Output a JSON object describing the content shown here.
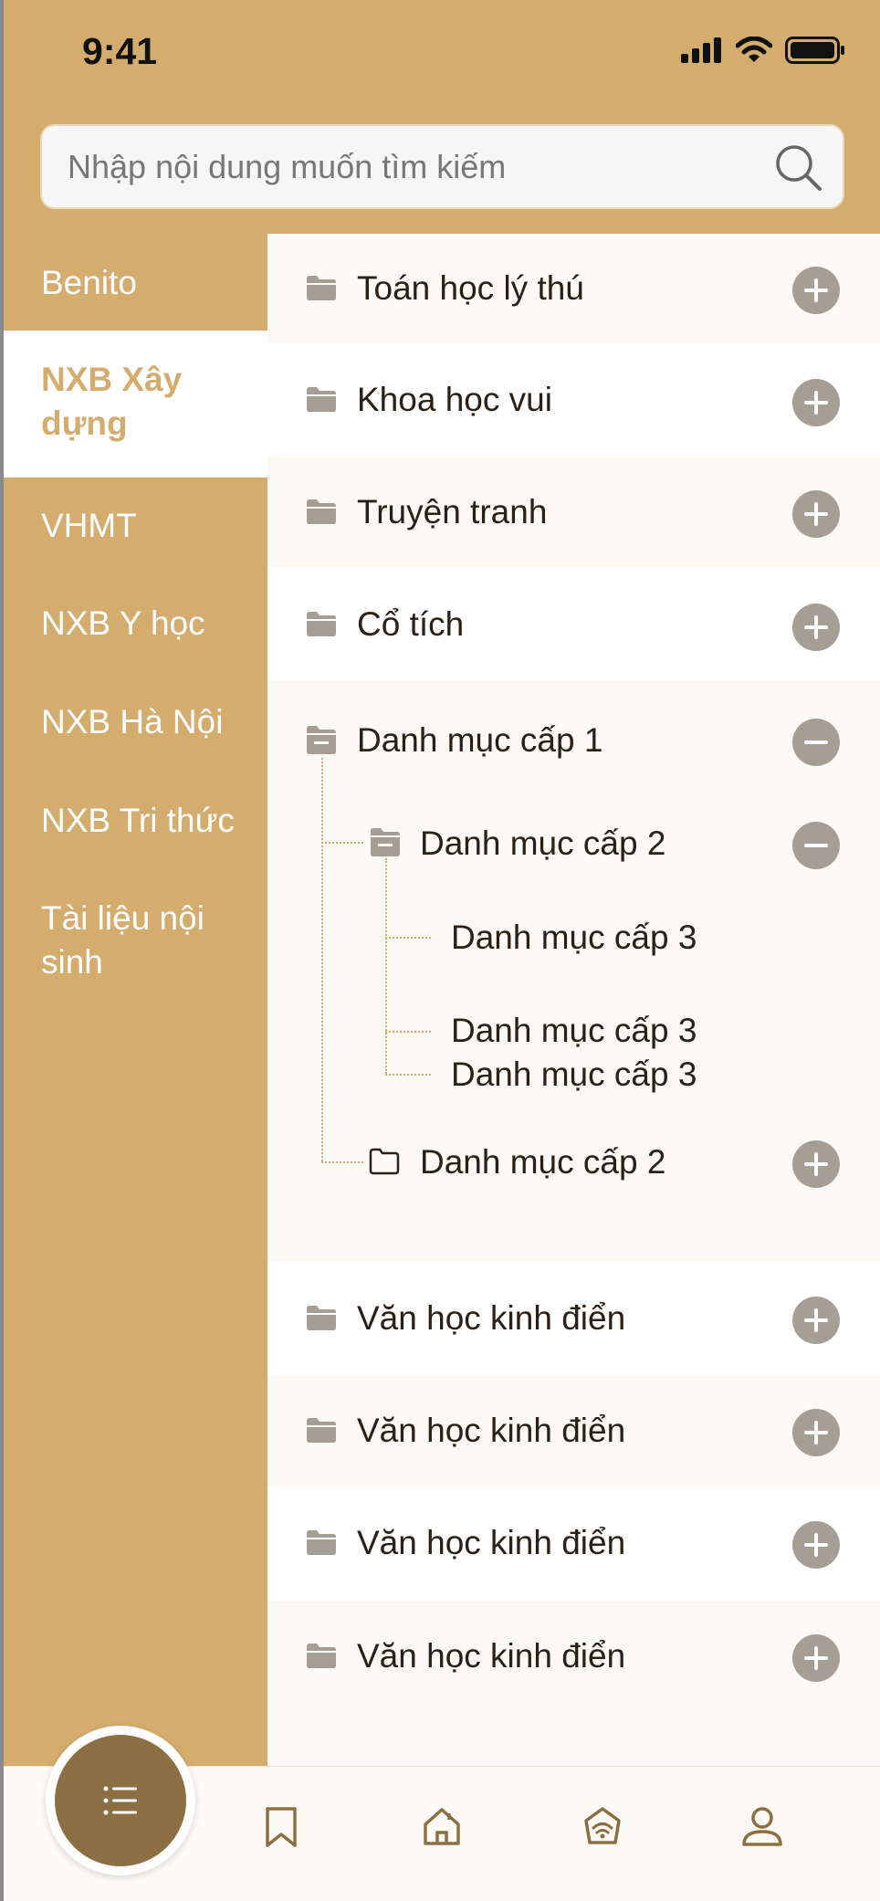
{
  "status_bar": {
    "time": "9:41"
  },
  "search": {
    "placeholder": "Nhập nội dung muốn tìm kiếm",
    "value": ""
  },
  "sidebar": {
    "items": [
      {
        "label": "Benito",
        "active": false
      },
      {
        "label": "NXB Xây dựng",
        "active": true
      },
      {
        "label": "VHMT",
        "active": false
      },
      {
        "label": "NXB Y học",
        "active": false
      },
      {
        "label": "NXB Hà Nội",
        "active": false
      },
      {
        "label": "NXB Tri thức",
        "active": false
      },
      {
        "label": "Tài liệu nội sinh",
        "active": false
      }
    ]
  },
  "categories": [
    {
      "label": "Toán học lý thú",
      "state": "collapsed"
    },
    {
      "label": "Khoa học vui",
      "state": "collapsed"
    },
    {
      "label": "Truyện tranh",
      "state": "collapsed"
    },
    {
      "label": "Cổ tích",
      "state": "collapsed"
    },
    {
      "label": "Danh mục cấp 1",
      "state": "expanded",
      "children": [
        {
          "label": "Danh mục cấp 2",
          "state": "expanded",
          "children": [
            {
              "label": "Danh mục cấp 3"
            },
            {
              "label": "Danh mục cấp 3"
            },
            {
              "label": "Danh mục cấp 3"
            }
          ]
        },
        {
          "label": "Danh mục cấp 2",
          "state": "collapsed"
        }
      ]
    },
    {
      "label": "Văn học kinh điển",
      "state": "collapsed"
    },
    {
      "label": "Văn học kinh điển",
      "state": "collapsed"
    },
    {
      "label": "Văn học kinh điển",
      "state": "collapsed"
    },
    {
      "label": "Văn học kinh điển",
      "state": "collapsed"
    }
  ],
  "bottom_nav": {
    "items": [
      {
        "icon": "list-icon",
        "active": true
      },
      {
        "icon": "bookmark-icon",
        "active": false
      },
      {
        "icon": "home-icon",
        "active": false
      },
      {
        "icon": "wifi-home-icon",
        "active": false
      },
      {
        "icon": "user-icon",
        "active": false
      }
    ]
  },
  "colors": {
    "brand": "#d4ad6e",
    "active_nav": "#8b6f43",
    "panel_bg": "#fdfaf5",
    "toggle_button": "#a69e94",
    "text_dark": "#2a2015"
  }
}
